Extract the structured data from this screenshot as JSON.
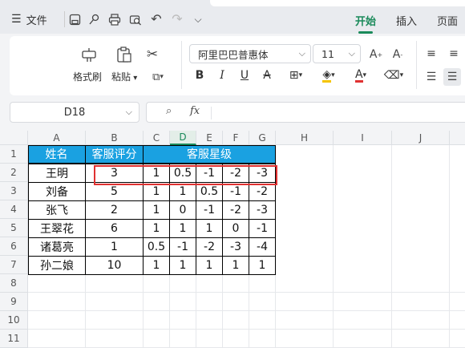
{
  "menu": {
    "hamburger_icon": "menu-icon",
    "file_label": "文件"
  },
  "ribbon_tabs": [
    {
      "label": "开始",
      "active": true
    },
    {
      "label": "插入",
      "active": false
    },
    {
      "label": "页面",
      "active": false
    }
  ],
  "clipboard": {
    "format_painter": "格式刷",
    "paste": "粘贴"
  },
  "font": {
    "name": "阿里巴巴普惠体",
    "size": "11"
  },
  "formula_bar": {
    "cell_ref": "D18",
    "fx": "fx",
    "value": ""
  },
  "columns": [
    "A",
    "B",
    "C",
    "D",
    "E",
    "F",
    "G",
    "H",
    "I",
    "J"
  ],
  "selected_column": "D",
  "rows": [
    "1",
    "2",
    "3",
    "4",
    "5",
    "6",
    "7",
    "8",
    "9",
    "10",
    "11"
  ],
  "table": {
    "header": {
      "name": "姓名",
      "rating": "客服评分",
      "stars": "客服星级"
    },
    "data": [
      {
        "name": "王明",
        "rating": "3",
        "c": "1",
        "d": "0.5",
        "e": "-1",
        "f": "-2",
        "g": "-3"
      },
      {
        "name": "刘备",
        "rating": "5",
        "c": "1",
        "d": "1",
        "e": "0.5",
        "f": "-1",
        "g": "-2"
      },
      {
        "name": "张飞",
        "rating": "2",
        "c": "1",
        "d": "0",
        "e": "-1",
        "f": "-2",
        "g": "-3"
      },
      {
        "name": "王翠花",
        "rating": "6",
        "c": "1",
        "d": "1",
        "e": "1",
        "f": "0",
        "g": "-1"
      },
      {
        "name": "诸葛亮",
        "rating": "1",
        "c": "0.5",
        "d": "-1",
        "e": "-2",
        "f": "-3",
        "g": "-4"
      },
      {
        "name": "孙二娘",
        "rating": "10",
        "c": "1",
        "d": "1",
        "e": "1",
        "f": "1",
        "g": "1"
      }
    ]
  },
  "colors": {
    "header_fill": "#1aa1e1",
    "accent": "#1a8a5a",
    "highlight_border": "#e03131"
  }
}
